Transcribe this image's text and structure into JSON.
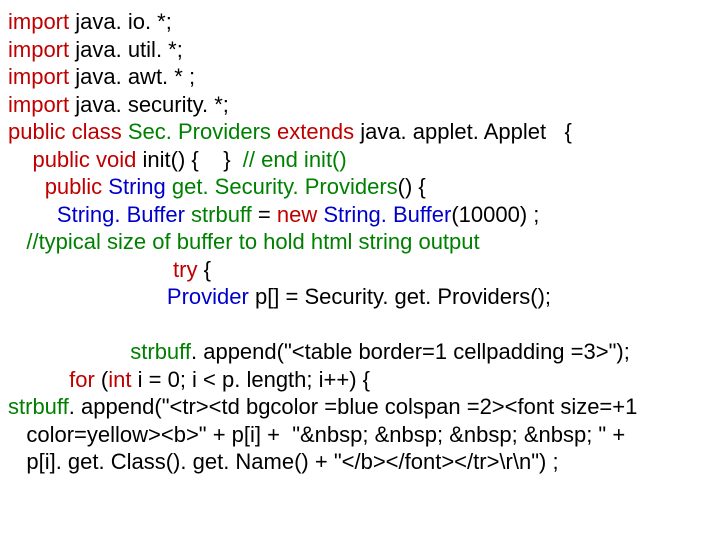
{
  "code": {
    "l1": {
      "kw": "import",
      "rest": " java. io. *;"
    },
    "l2": {
      "kw": "import",
      "rest": " java. util. *;"
    },
    "l3": {
      "kw": "import",
      "rest": " java. awt. * ;"
    },
    "l4": {
      "kw": "import",
      "rest": " java. security. *;"
    },
    "l5": {
      "kw1": "public class ",
      "cls": "Sec. Providers",
      "kw2": " extends",
      "rest": " java. applet. Applet   {"
    },
    "l6": {
      "pre": "    ",
      "kw": "public void",
      "mid": " init() {    }  ",
      "cm": "// end init()"
    },
    "l7": {
      "pre": "      ",
      "kw": "public",
      "typ": " String",
      "grn": " get. Security. Providers",
      "rest": "() {"
    },
    "l8": {
      "pre": "        ",
      "typ": "String. Buffer",
      "grn": " strbuff",
      "mid": " = ",
      "kw": "new",
      "typ2": " String. Buffer",
      "rest": "(10000) ;"
    },
    "l9": {
      "pre": "   ",
      "cm": "//typical size of buffer to hold html string output"
    },
    "l10": {
      "pre": "                           ",
      "kw": "try",
      "rest": " {"
    },
    "l11": {
      "pre": "                          ",
      "typ": "Provider",
      "rest": " p[] = Security. get. Providers();"
    },
    "l12": "",
    "l13": {
      "pre": "                    ",
      "grn": "strbuff",
      "rest": ". append(\"<table border=1 cellpadding =3>\");"
    },
    "l14": {
      "pre": "          ",
      "kw": "for",
      "mid": " (",
      "kw2": "int",
      "rest": " i = 0; i < p. length; i++) {"
    },
    "l15": {
      "grn": "strbuff",
      "rest": ". append(\"<tr><td bgcolor =blue colspan =2><font size=+1"
    },
    "l16": {
      "pre": "   ",
      "rest": "color=yellow><b>\" + p[i] +  \"&nbsp; &nbsp; &nbsp; &nbsp; \" +"
    },
    "l17": {
      "pre": "   ",
      "rest": "p[i]. get. Class(). get. Name() + \"</b></font></tr>\\r\\n\") ;"
    }
  }
}
